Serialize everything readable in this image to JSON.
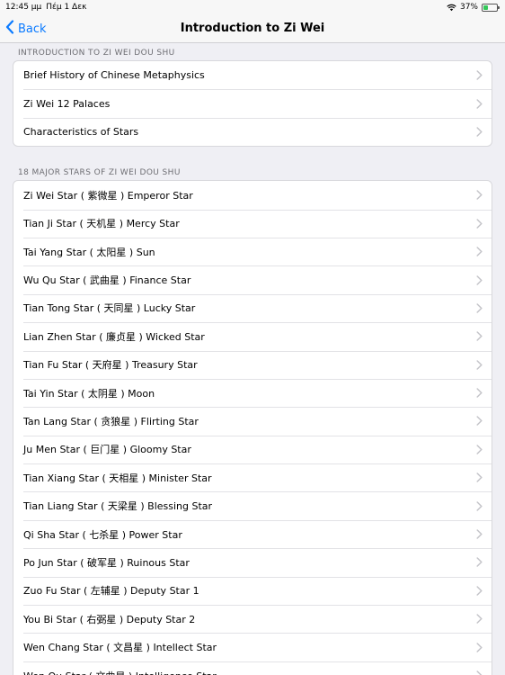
{
  "status_bar": {
    "time": "12:45 μμ",
    "date": "Πέμ 1 Δεκ",
    "battery": "37%",
    "battery_level": 0.37,
    "icons": [
      "wifi-icon",
      "battery-icon"
    ]
  },
  "nav": {
    "back_label": "Back",
    "title": "Introduction to Zi Wei"
  },
  "sections": [
    {
      "header": "INTRODUCTION TO ZI WEI DOU SHU",
      "items": [
        "Brief History of Chinese Metaphysics",
        "Zi Wei 12 Palaces",
        "Characteristics of Stars"
      ]
    },
    {
      "header": "18 MAJOR STARS OF ZI WEI DOU SHU",
      "items": [
        "Zi Wei Star ( 紫微星 ) Emperor Star",
        "Tian Ji Star ( 天机星 ) Mercy Star",
        "Tai Yang Star ( 太阳星 ) Sun",
        "Wu Qu Star ( 武曲星 ) Finance Star",
        "Tian Tong Star ( 天同星 ) Lucky Star",
        "Lian Zhen Star ( 廉贞星 ) Wicked Star",
        "Tian Fu Star ( 天府星 ) Treasury Star",
        "Tai Yin Star ( 太阴星 ) Moon",
        "Tan Lang Star ( 贪狼星 ) Flirting Star",
        "Ju Men Star ( 巨门星 ) Gloomy Star",
        "Tian Xiang Star ( 天相星 ) Minister Star",
        "Tian Liang Star ( 天梁星 ) Blessing Star",
        "Qi Sha Star ( 七杀星 ) Power Star",
        "Po Jun Star ( 破军星 ) Ruinous Star",
        "Zuo Fu Star ( 左辅星 ) Deputy Star 1",
        "You Bi Star ( 右弼星 ) Deputy Star 2",
        "Wen Chang Star ( 文昌星 ) Intellect Star",
        "Wen Qu Star ( 文曲星 ) Intelligence Star"
      ]
    }
  ],
  "colors": {
    "accent": "#0a7aff",
    "background": "#efeff4",
    "battery": "#34c759"
  }
}
